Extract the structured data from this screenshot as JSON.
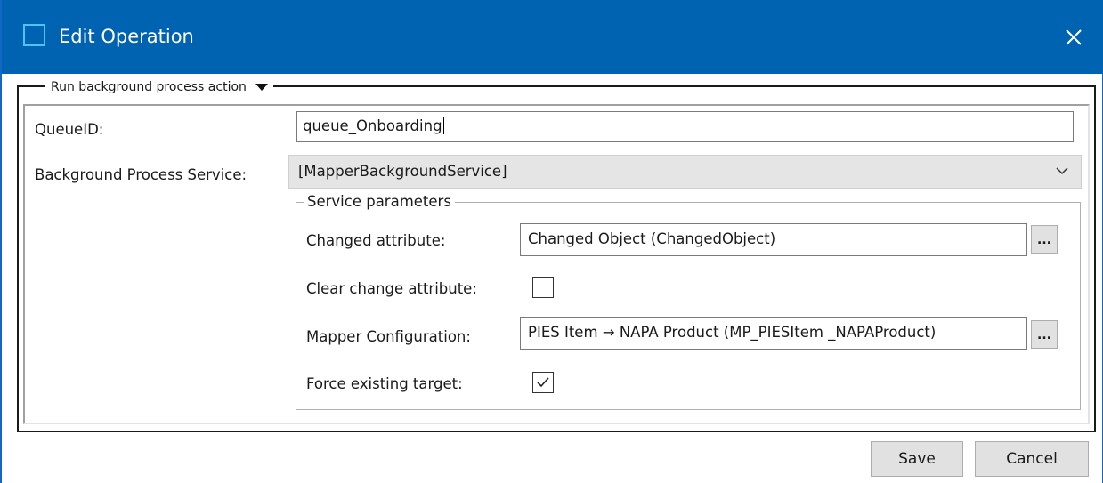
{
  "window": {
    "title": "Edit Operation",
    "accent_color": "#0063b1",
    "title_icon": "window-app-icon",
    "close_icon": "close-icon"
  },
  "action_group": {
    "legend": "Run background process action",
    "dropdown_icon": "triangle-down-icon"
  },
  "queue": {
    "label": "QueueID:",
    "value": "queue_Onboarding"
  },
  "service": {
    "label": "Background Process Service:",
    "selected": "[MapperBackgroundService]",
    "chevron_icon": "chevron-down-icon"
  },
  "service_parameters": {
    "legend": "Service parameters",
    "changed_attribute": {
      "label": "Changed attribute:",
      "value": "Changed Object (ChangedObject)",
      "browse_label": "..."
    },
    "clear_change_attribute": {
      "label": "Clear change attribute:",
      "checked": false
    },
    "mapper_configuration": {
      "label": "Mapper Configuration:",
      "value": "PIES Item → NAPA Product (MP_PIESItem _NAPAProduct)",
      "browse_label": "..."
    },
    "force_existing_target": {
      "label": "Force existing target:",
      "checked": true
    }
  },
  "footer": {
    "save_label": "Save",
    "cancel_label": "Cancel"
  }
}
